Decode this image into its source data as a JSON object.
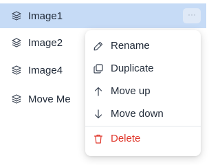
{
  "layers": {
    "items": [
      {
        "label": "Image1",
        "icon": "layers-icon",
        "selected": true
      },
      {
        "label": "Image2",
        "icon": "layers-icon",
        "selected": false
      },
      {
        "label": "Image4",
        "icon": "layers-icon",
        "selected": false
      },
      {
        "label": "Move Me",
        "icon": "layers-icon",
        "selected": false
      }
    ],
    "more_button_label": "···"
  },
  "context_menu": {
    "items": [
      {
        "label": "Rename",
        "icon": "pencil-icon"
      },
      {
        "label": "Duplicate",
        "icon": "duplicate-icon"
      },
      {
        "label": "Move up",
        "icon": "arrow-up-icon"
      },
      {
        "label": "Move down",
        "icon": "arrow-down-icon"
      },
      {
        "label": "Delete",
        "icon": "trash-icon",
        "danger": true
      }
    ]
  },
  "colors": {
    "selected_row": "#c6dbf6",
    "danger": "#e0372b",
    "text": "#1f2937"
  }
}
